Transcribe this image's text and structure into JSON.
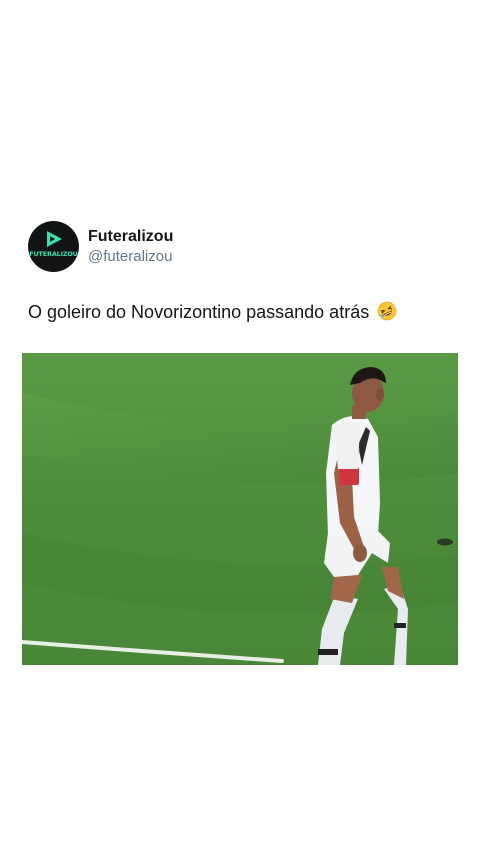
{
  "post": {
    "account": {
      "display_name": "Futeralizou",
      "handle": "@futeralizou",
      "avatar_text": "FUTERALIZOU",
      "avatar_text_color": "#3fe0b0",
      "avatar_background": "#111315"
    },
    "text": "O goleiro do Novorizontino passando atrás",
    "emoji": "rolling-on-floor-laughing-emoji",
    "media": {
      "type": "video-still",
      "description_icon": "soccer-player-image"
    }
  }
}
